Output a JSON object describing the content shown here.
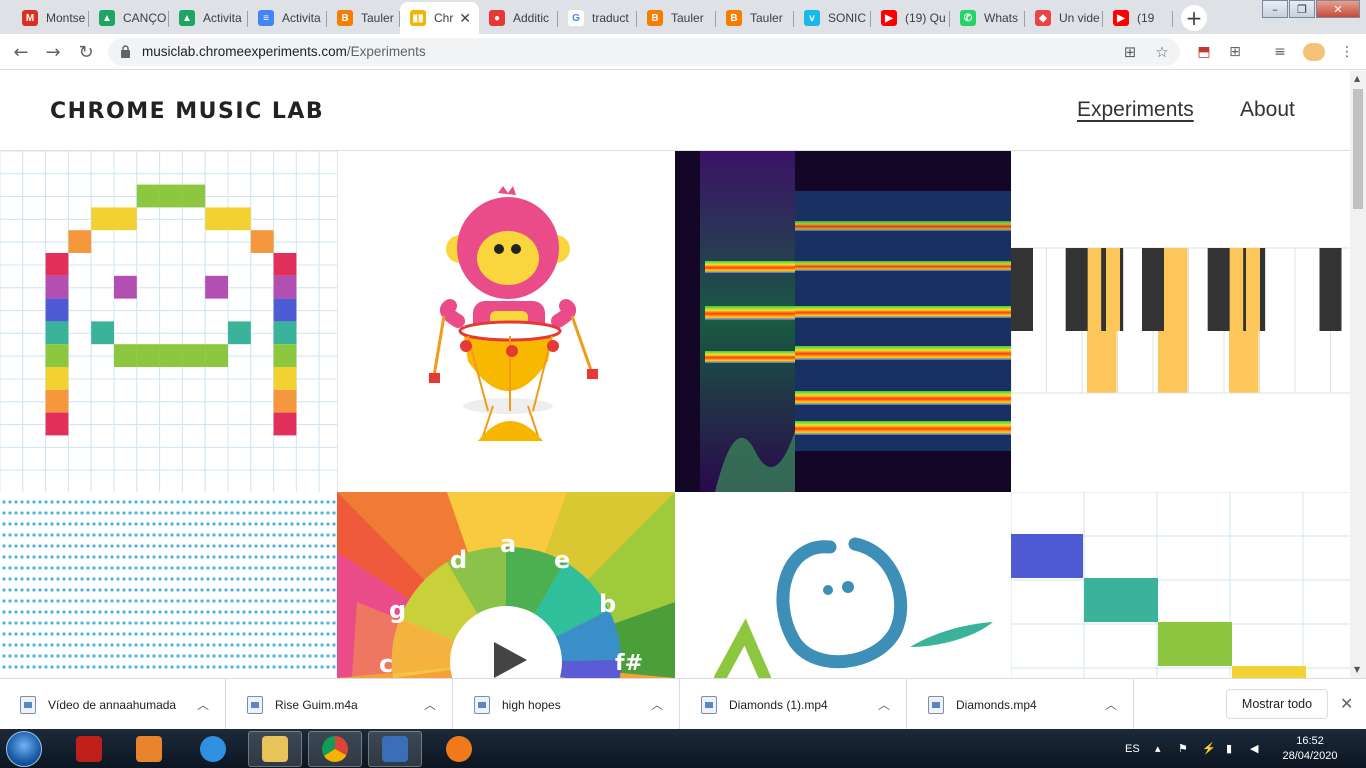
{
  "tabs": [
    {
      "label": "Montse",
      "icon": "gmail-icon",
      "color": "#d93025",
      "glyph": "M"
    },
    {
      "label": "CANÇO",
      "icon": "drive-icon",
      "color": "#1fa463",
      "glyph": "▲"
    },
    {
      "label": "Activita",
      "icon": "drive-icon",
      "color": "#1fa463",
      "glyph": "▲"
    },
    {
      "label": "Activita",
      "icon": "docs-icon",
      "color": "#4285f4",
      "glyph": "≡"
    },
    {
      "label": "Tauler",
      "icon": "blogger-icon",
      "color": "#f57d00",
      "glyph": "B"
    },
    {
      "label": "Chr",
      "icon": "musiclab-icon",
      "color": "#f4b400",
      "glyph": "▮▮"
    },
    {
      "label": "Additic",
      "icon": "addictive-icon",
      "color": "#e53935",
      "glyph": "●"
    },
    {
      "label": "traduct",
      "icon": "google-icon",
      "color": "#ffffff",
      "glyph": "G"
    },
    {
      "label": "Tauler",
      "icon": "blogger-icon",
      "color": "#f57d00",
      "glyph": "B"
    },
    {
      "label": "Tauler",
      "icon": "blogger-icon",
      "color": "#f57d00",
      "glyph": "B"
    },
    {
      "label": "SONIC",
      "icon": "vimeo-icon",
      "color": "#1ab7ea",
      "glyph": "v"
    },
    {
      "label": "(19) Qu",
      "icon": "youtube-icon",
      "color": "#ff0000",
      "glyph": "▶"
    },
    {
      "label": "Whats",
      "icon": "whatsapp-icon",
      "color": "#25d366",
      "glyph": "✆"
    },
    {
      "label": "Un vide",
      "icon": "diamond-icon",
      "color": "#e84545",
      "glyph": "◆"
    },
    {
      "label": "(19",
      "icon": "youtube-icon",
      "color": "#ff0000",
      "glyph": "▶"
    }
  ],
  "address": {
    "host": "musiclab.chromeexperiments.com",
    "path": "/Experiments"
  },
  "site": {
    "title": "CHROME MUSIC LAB",
    "nav": [
      {
        "label": "Experiments",
        "current": true
      },
      {
        "label": "About",
        "current": false
      }
    ]
  },
  "experiments": [
    {
      "name": "song-maker-tile"
    },
    {
      "name": "rhythm-tile"
    },
    {
      "name": "spectrogram-tile"
    },
    {
      "name": "chords-tile"
    },
    {
      "name": "sound-waves-tile"
    },
    {
      "name": "arpeggios-tile",
      "notes": [
        "d",
        "a",
        "e",
        "g",
        "b",
        "c",
        "f#"
      ]
    },
    {
      "name": "kandinsky-tile"
    },
    {
      "name": "melody-maker-tile"
    }
  ],
  "downloads": {
    "items": [
      {
        "name": "Vídeo de annaahumada"
      },
      {
        "name": "Rise Guim.m4a"
      },
      {
        "name": "high hopes"
      },
      {
        "name": "Diamonds (1).mp4"
      },
      {
        "name": "Diamonds.mp4"
      }
    ],
    "show_all_label": "Mostrar todo"
  },
  "taskbar": {
    "language": "ES",
    "time": "16:52",
    "date": "28/04/2020"
  }
}
